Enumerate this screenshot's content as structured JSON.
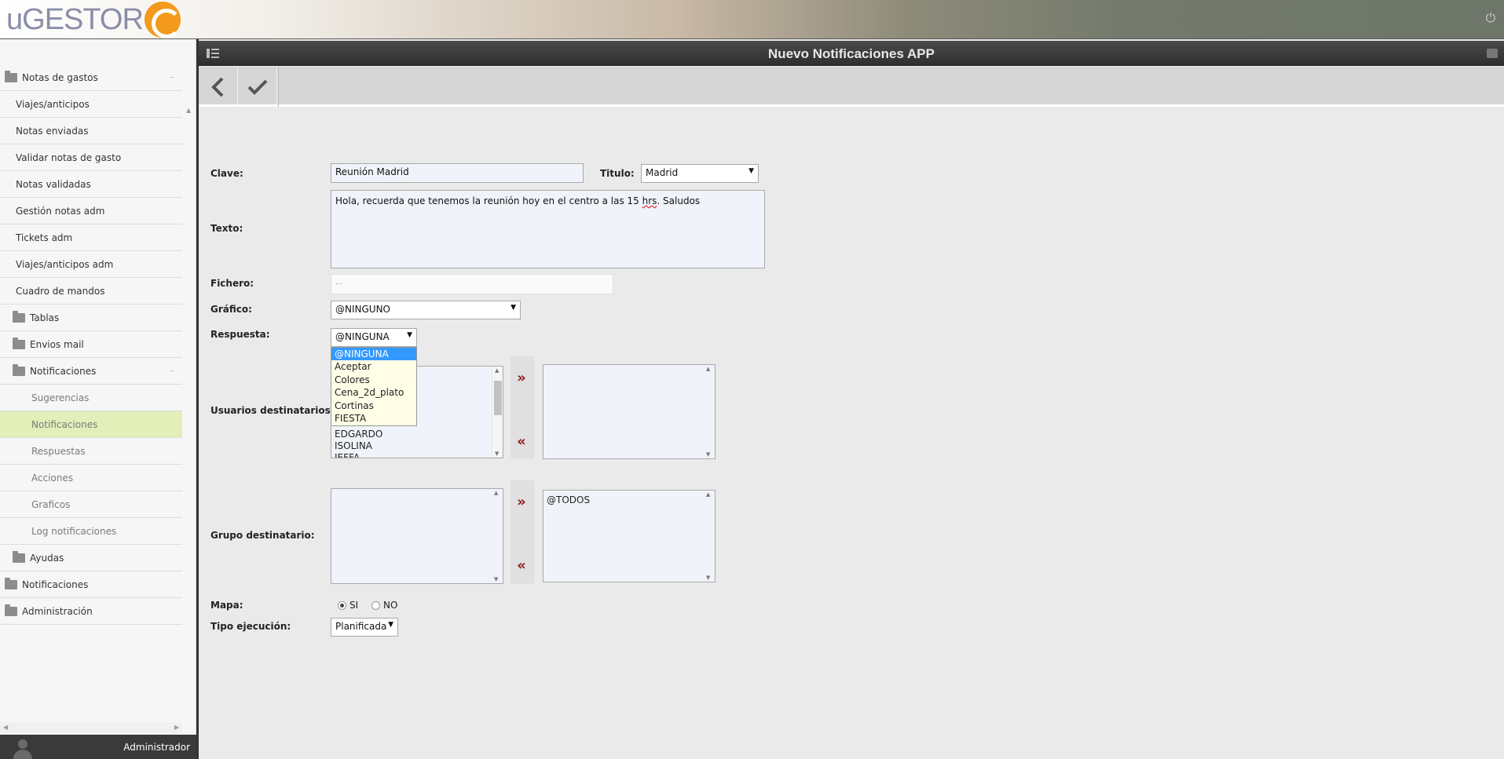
{
  "app": {
    "logo_text": "uGESTOR",
    "user_name": "Administrador"
  },
  "header": {
    "title": "Nuevo Notificaciones APP"
  },
  "sidebar": {
    "items": [
      {
        "label": "Notas de gastos",
        "level": 0,
        "folder": true,
        "expanded": true
      },
      {
        "label": "Viajes/anticipos",
        "level": 1
      },
      {
        "label": "Notas enviadas",
        "level": 1
      },
      {
        "label": "Validar notas de gasto",
        "level": 1
      },
      {
        "label": "Notas validadas",
        "level": 1
      },
      {
        "label": "Gestión notas adm",
        "level": 1
      },
      {
        "label": "Tickets adm",
        "level": 1
      },
      {
        "label": "Viajes/anticipos adm",
        "level": 1
      },
      {
        "label": "Cuadro de mandos",
        "level": 1
      },
      {
        "label": "Tablas",
        "level": 1,
        "folder": true
      },
      {
        "label": "Envios mail",
        "level": 1,
        "folder": true
      },
      {
        "label": "Notificaciones",
        "level": 1,
        "folder": true,
        "expanded": true
      },
      {
        "label": "Sugerencias",
        "level": 2
      },
      {
        "label": "Notificaciones",
        "level": 2,
        "active": true
      },
      {
        "label": "Respuestas",
        "level": 2
      },
      {
        "label": "Acciones",
        "level": 2
      },
      {
        "label": "Graficos",
        "level": 2
      },
      {
        "label": "Log notificaciones",
        "level": 2
      },
      {
        "label": "Ayudas",
        "level": 1,
        "folder": true
      },
      {
        "label": "Notificaciones",
        "level": 0,
        "folder": true
      },
      {
        "label": "Administración",
        "level": 0,
        "folder": true
      }
    ]
  },
  "form": {
    "clave_label": "Clave:",
    "clave_value": "Reunión Madrid",
    "titulo_label": "Titulo:",
    "titulo_value": "Madrid",
    "texto_label": "Texto:",
    "texto_value_pre": "Hola, recuerda que tenemos la reunión hoy en el centro a las 15 ",
    "texto_value_spell": "hrs",
    "texto_value_post": ". Saludos",
    "fichero_label": "Fichero:",
    "fichero_placeholder": "...",
    "grafico_label": "Gráfico:",
    "grafico_value": "@NINGUNO",
    "respuesta_label": "Respuesta:",
    "respuesta_value": "@NINGUNA",
    "respuesta_options": [
      "@NINGUNA",
      "Aceptar",
      "Colores",
      "Cena_2d_plato",
      "Cortinas",
      "FIESTA"
    ],
    "usuarios_label": "Usuarios destinatarios:",
    "usuarios_available": [
      "EDGARDO",
      "ISOLINA",
      "JEFFA"
    ],
    "usuarios_selected": [],
    "grupo_label": "Grupo destinatario:",
    "grupo_available": [],
    "grupo_selected": [
      "@TODOS"
    ],
    "mapa_label": "Mapa:",
    "mapa_si": "SI",
    "mapa_no": "NO",
    "mapa_value": "SI",
    "tipo_label": "Tipo ejecución:",
    "tipo_value": "Planificada"
  },
  "colors": {
    "accent_active": "#e2efb9",
    "titlebar": "#333333",
    "arrow": "#8b1a1a",
    "logo_orange": "#f39a1d"
  }
}
